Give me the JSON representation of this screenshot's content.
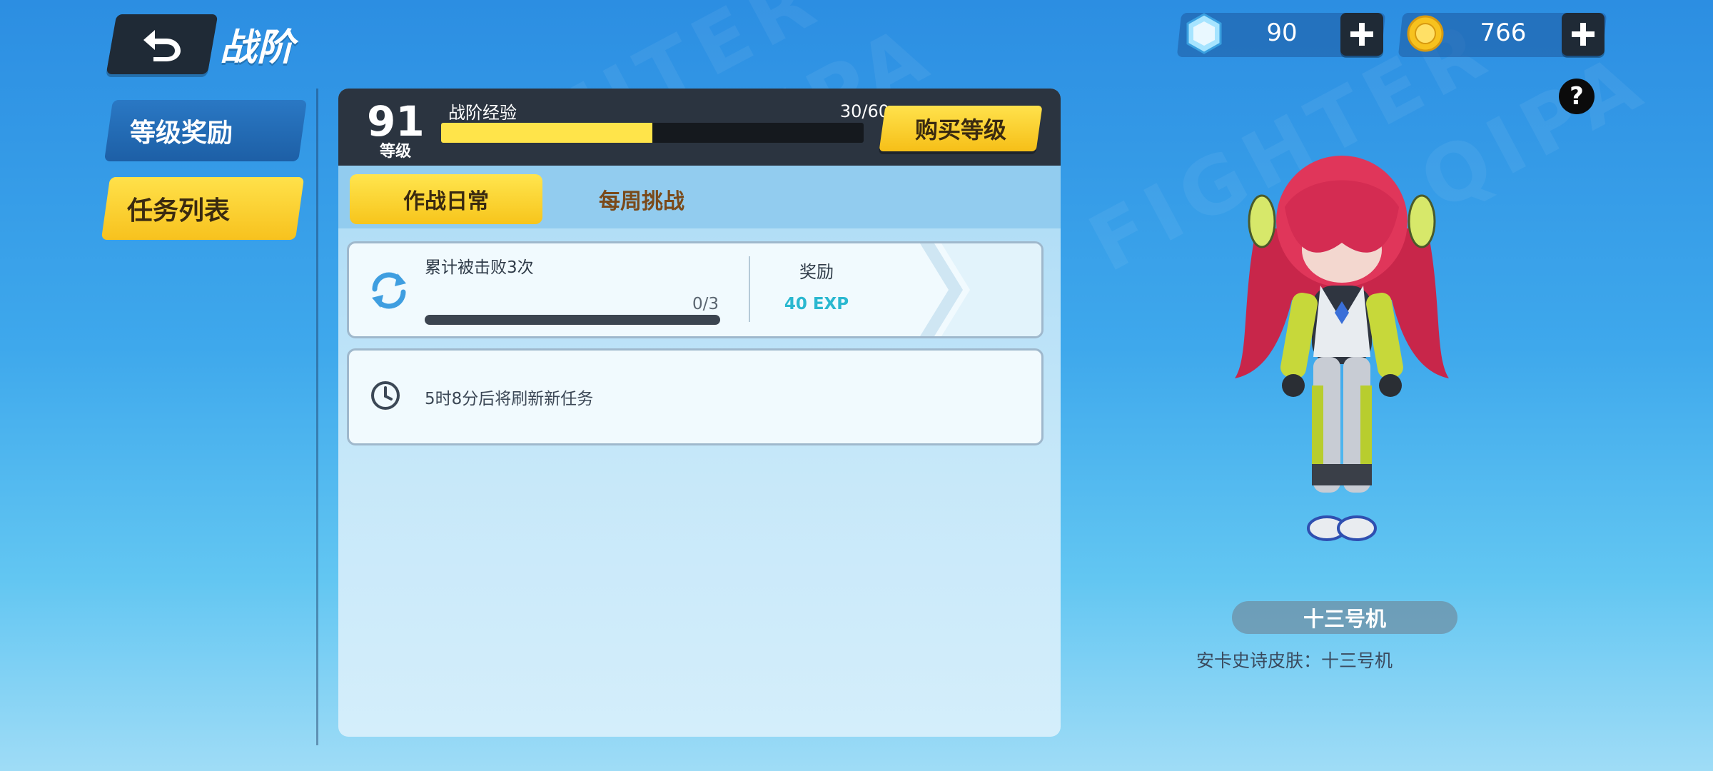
{
  "header": {
    "back_icon": "back-arrow-icon",
    "title": "战阶"
  },
  "sidebar": {
    "items": [
      {
        "label": "等级奖励",
        "active": false
      },
      {
        "label": "任务列表",
        "active": true
      }
    ]
  },
  "battle_pass": {
    "level": "91",
    "level_label": "等级",
    "exp_label": "战阶经验",
    "exp_text": "30/60",
    "exp_progress": 0.5,
    "buy_label": "购买等级"
  },
  "tabs": [
    {
      "label": "作战日常",
      "active": true
    },
    {
      "label": "每周挑战",
      "active": false
    }
  ],
  "task": {
    "icon": "refresh-icon",
    "title": "累计被击败3次",
    "progress_text": "0/3",
    "progress": 0,
    "reward_label": "奖励",
    "reward_value": "40 EXP"
  },
  "refresh_notice": {
    "icon": "clock-icon",
    "text": "5时8分后将刷新新任务"
  },
  "currency": {
    "gems": "90",
    "coins": "766",
    "gem_icon": "diamond-icon",
    "coin_icon": "coin-icon"
  },
  "help_label": "?",
  "character": {
    "name": "十三号机",
    "description": "安卡史诗皮肤：十三号机"
  },
  "colors": {
    "accent_yellow": "#ffd43a",
    "panel_dark": "#2b3440",
    "reward_cyan": "#2ab8d0"
  }
}
